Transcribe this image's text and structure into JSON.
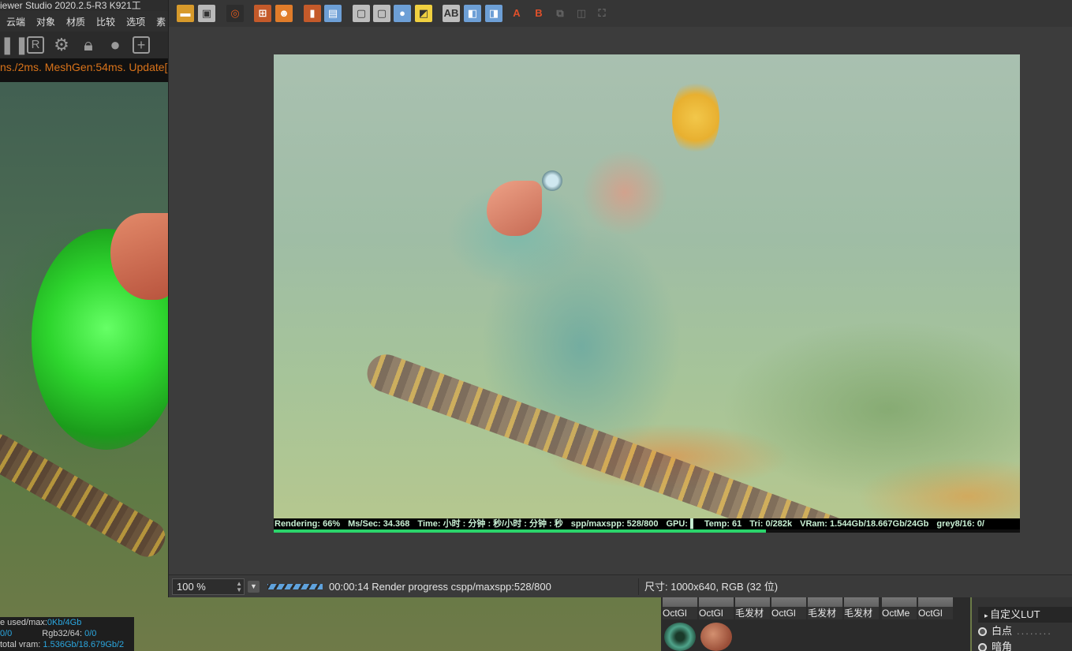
{
  "background_app": {
    "title": "iewer Studio 2020.2.5-R3  K921工",
    "menu": [
      "云端",
      "对象",
      "材质",
      "比较",
      "选项",
      "素"
    ],
    "timing_text": "ns./2ms. MeshGen:54ms. Update[C",
    "stats": {
      "line1_label": "e used/max:",
      "line1_value": "0Kb/4Gb",
      "line2_left": "0/0",
      "line2_label": "Rgb32/64:",
      "line2_value": "0/0",
      "line3_label": "total vram:",
      "line3_value": "1.536Gb/18.679Gb/2"
    },
    "materials": [
      "OctGl",
      "OctGl",
      "毛发材",
      "OctGl",
      "毛发材",
      "毛发材",
      "OctMe",
      "OctGl"
    ],
    "side_panel": {
      "lut": "自定义LUT",
      "options": [
        "白点",
        "暗角"
      ]
    }
  },
  "picture_viewer": {
    "status": {
      "rendering": "Rendering: 66%",
      "ms_sec": "Ms/Sec: 34.368",
      "time": "Time: 小时 : 分钟 : 秒/小时 : 分钟 : 秒",
      "spp": "spp/maxspp: 528/800",
      "gpu": "GPU: ▌",
      "temp": "Temp: 61",
      "tri": "Tri: 0/282k",
      "vram": "VRam: 1.544Gb/18.667Gb/24Gb",
      "grey": "grey8/16: 0/"
    },
    "progress_fraction": 0.66,
    "zoom": "100 %",
    "render_progress": "00:00:14 Render progress  cspp/maxspp:528/800",
    "size_info": "尺寸: 1000x640, RGB (32 位)",
    "toolbar_labels": {
      "btn_a": "A",
      "btn_b": "B"
    }
  }
}
